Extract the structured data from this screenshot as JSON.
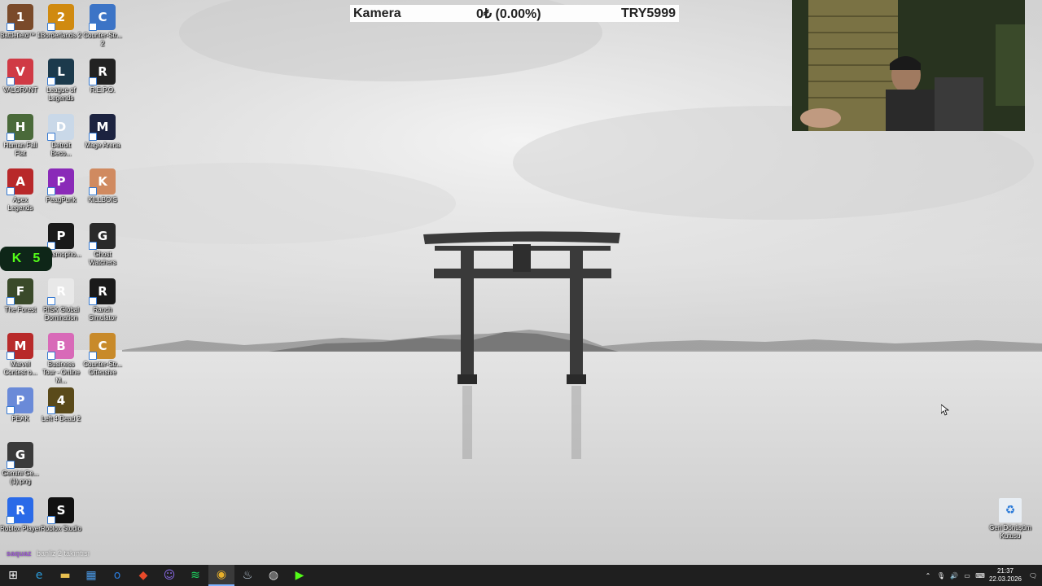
{
  "overlay": {
    "camera_label": "Kamera",
    "balance": "0₺ (0.00%)",
    "target": "TRY5999"
  },
  "desktop_icons": [
    {
      "label": "Battlefield™ 1",
      "color": "#7a4a2a",
      "glyph": "1"
    },
    {
      "label": "Borderlands 2",
      "color": "#d08a10",
      "glyph": "2"
    },
    {
      "label": "Counter-Str... 2",
      "color": "#3c74c6",
      "glyph": "C"
    },
    {
      "label": "VALORANT",
      "color": "#d03a45",
      "glyph": "V"
    },
    {
      "label": "League of Legends",
      "color": "#1c3a4c",
      "glyph": "L"
    },
    {
      "label": "R.E.P.O.",
      "color": "#222",
      "glyph": "R"
    },
    {
      "label": "Human Fall Flat",
      "color": "#4a6a3a",
      "glyph": "H"
    },
    {
      "label": "Detroit Beco...",
      "color": "#c9d8e8",
      "glyph": "D"
    },
    {
      "label": "Mage Arena",
      "color": "#1c2340",
      "glyph": "M"
    },
    {
      "label": "Apex Legends",
      "color": "#b8282a",
      "glyph": "A"
    },
    {
      "label": "PeagPunk",
      "color": "#8a2ab8",
      "glyph": "P"
    },
    {
      "label": "KILLBOIS",
      "color": "#d08a60",
      "glyph": "K"
    },
    {
      "label": "Phasmopho...",
      "color": "#1a1a1a",
      "glyph": "P"
    },
    {
      "label": "Ghost Watchers",
      "color": "#2a2a2a",
      "glyph": "G"
    },
    {
      "label": "The Forest",
      "color": "#3a4a2a",
      "glyph": "F"
    },
    {
      "label": "RISK Global Domination",
      "color": "#e8e8e8",
      "glyph": "R"
    },
    {
      "label": "Ranch Simulator",
      "color": "#1a1a1a",
      "glyph": "R"
    },
    {
      "label": "Marvel Contest o...",
      "color": "#b82a2a",
      "glyph": "M"
    },
    {
      "label": "Business Tour - Online M...",
      "color": "#d86ab8",
      "glyph": "B"
    },
    {
      "label": "Counter-Str... Offensive",
      "color": "#c88a2a",
      "glyph": "C"
    },
    {
      "label": "PEAK",
      "color": "#6a8ad8",
      "glyph": "P"
    },
    {
      "label": "Left 4 Dead 2",
      "color": "#5a4a1a",
      "glyph": "4"
    },
    {
      "label": "Gemini Ge... (1).png",
      "color": "#3a3a3a",
      "glyph": "G"
    },
    {
      "label": "Roblox Player",
      "color": "#2a6ae8",
      "glyph": "R"
    },
    {
      "label": "Roblox Studio",
      "color": "#111",
      "glyph": "S"
    }
  ],
  "kick_badge": {
    "letter": "K",
    "count": "5"
  },
  "chat": {
    "user": "saquaz",
    "message": "banliz 2 takıntısı"
  },
  "recycle_bin": {
    "label": "Geri Dönüşüm Kutusu"
  },
  "taskbar": {
    "apps": [
      {
        "name": "start-button",
        "glyph": "⊞",
        "color": "#ffffff"
      },
      {
        "name": "edge-icon",
        "glyph": "e",
        "color": "#2a9ad8"
      },
      {
        "name": "file-explorer-icon",
        "glyph": "▬",
        "color": "#e8c050"
      },
      {
        "name": "store-icon",
        "glyph": "▦",
        "color": "#4a9ae8"
      },
      {
        "name": "outlook-icon",
        "glyph": "o",
        "color": "#2a7ad8"
      },
      {
        "name": "brave-icon",
        "glyph": "◆",
        "color": "#e84a2a"
      },
      {
        "name": "discord-icon",
        "glyph": "☺",
        "color": "#8a6ae8"
      },
      {
        "name": "spotify-icon",
        "glyph": "≋",
        "color": "#1ed760"
      },
      {
        "name": "chrome-icon",
        "glyph": "◉",
        "color": "#e8b02a"
      },
      {
        "name": "steam-icon",
        "glyph": "♨",
        "color": "#c8d8e8"
      },
      {
        "name": "obs-icon",
        "glyph": "◍",
        "color": "#d8d8d8"
      },
      {
        "name": "kick-icon",
        "glyph": "▶",
        "color": "#53fc18"
      }
    ],
    "time": "21:37",
    "date": "22.03.2026"
  }
}
